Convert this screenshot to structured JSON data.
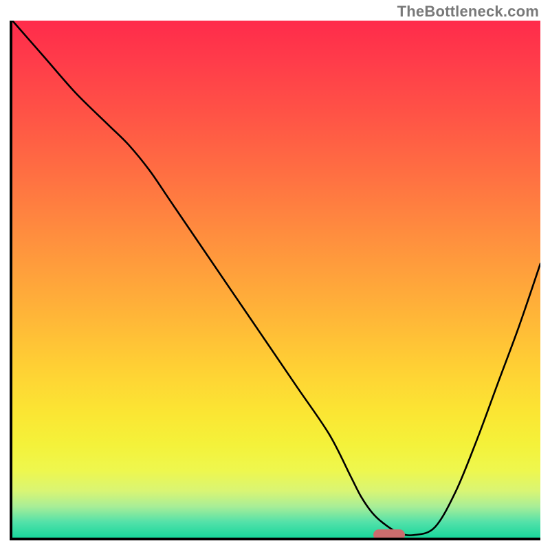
{
  "watermark": "TheBottleneck.com",
  "chart_data": {
    "type": "line",
    "title": "",
    "xlabel": "",
    "ylabel": "",
    "xlim": [
      0,
      100
    ],
    "ylim": [
      0,
      100
    ],
    "x": [
      0,
      6,
      12,
      18,
      22,
      26,
      30,
      36,
      42,
      48,
      54,
      60,
      64,
      66,
      68,
      70,
      73,
      76,
      80,
      84,
      88,
      92,
      96,
      100
    ],
    "values": [
      100,
      93,
      86,
      80,
      76,
      71,
      65,
      56,
      47,
      38,
      29,
      20,
      12,
      8,
      5,
      3,
      1,
      0.5,
      2,
      9,
      19,
      30,
      41,
      53
    ],
    "marker": {
      "x": 71,
      "y": 1,
      "shape": "pill",
      "color": "#cb6d6e"
    },
    "gradient": {
      "stops": [
        {
          "pos": 0.0,
          "color": "#ff2b4b"
        },
        {
          "pos": 0.3,
          "color": "#ff7042"
        },
        {
          "pos": 0.67,
          "color": "#ffd034"
        },
        {
          "pos": 0.87,
          "color": "#eef74e"
        },
        {
          "pos": 1.0,
          "color": "#19d79c"
        }
      ]
    }
  }
}
